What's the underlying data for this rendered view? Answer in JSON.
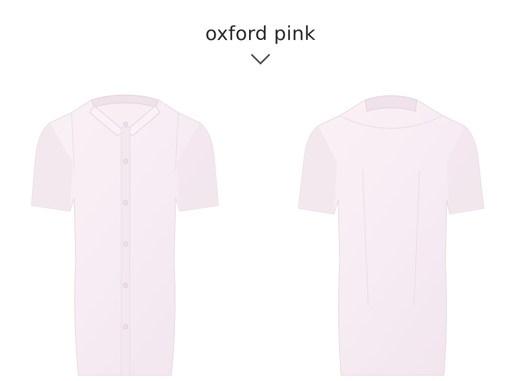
{
  "header": {
    "title": "oxford pink"
  },
  "icons": {
    "indicator": "chevron-down-icon"
  },
  "colors": {
    "shirt_fabric": "#f7ecf3",
    "shirt_shadow": "#eadbe5",
    "background": "#ffffff",
    "title_text": "#2a2a2a",
    "chevron": "#555555"
  },
  "images": {
    "front": "shirt-front-view",
    "back": "shirt-back-view"
  }
}
